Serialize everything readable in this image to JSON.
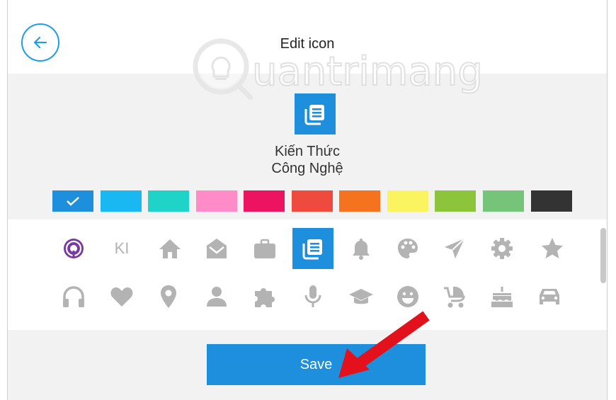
{
  "header": {
    "title": "Edit icon"
  },
  "watermark": {
    "text": "Quantrimang"
  },
  "preview": {
    "name_line1": "Kiến Thức",
    "name_line2": "Công Nghệ"
  },
  "colors": {
    "accent": "#1e8fdc",
    "swatches": [
      "#1e8fdc",
      "#1ab8f2",
      "#1fd3c9",
      "#ff8cc8",
      "#ec1460",
      "#ee4b3e",
      "#f5731f",
      "#faf460",
      "#8cc43c",
      "#76c47a",
      "#333333"
    ],
    "selected_swatch": 0
  },
  "icons": {
    "row1": [
      "podcast-icon",
      "ki-text-icon",
      "home-icon",
      "envelope-open-icon",
      "briefcase-icon",
      "newspaper-icon",
      "bell-icon",
      "palette-icon",
      "send-icon",
      "gear-icon",
      "star-icon"
    ],
    "row2": [
      "headphones-icon",
      "heart-icon",
      "map-pin-icon",
      "user-icon",
      "puzzle-icon",
      "microphone-icon",
      "graduation-cap-icon",
      "smiley-icon",
      "stroller-icon",
      "cake-icon",
      "car-icon"
    ],
    "ki_label": "KI",
    "selected": "newspaper-icon"
  },
  "footer": {
    "save_label": "Save"
  }
}
